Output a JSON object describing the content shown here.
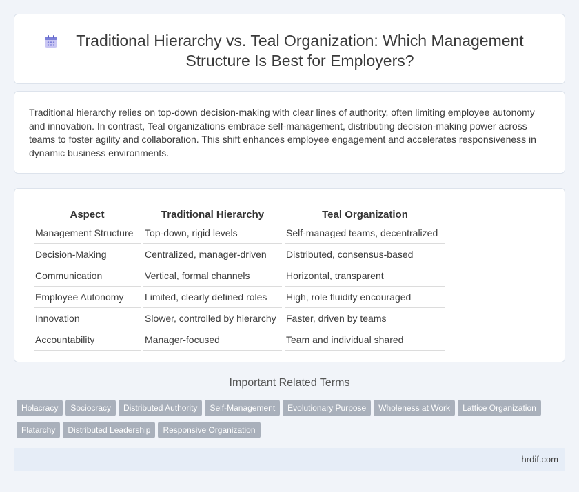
{
  "header": {
    "icon": "calendar-icon",
    "title": "Traditional Hierarchy vs. Teal Organization: Which Management Structure Is Best for Employers?"
  },
  "intro": {
    "text": "Traditional hierarchy relies on top-down decision-making with clear lines of authority, often limiting employee autonomy and innovation. In contrast, Teal organizations embrace self-management, distributing decision-making power across teams to foster agility and collaboration. This shift enhances employee engagement and accelerates responsiveness in dynamic business environments."
  },
  "comparison": {
    "headers": [
      "Aspect",
      "Traditional Hierarchy",
      "Teal Organization"
    ],
    "rows": [
      [
        "Management Structure",
        "Top-down, rigid levels",
        "Self-managed teams, decentralized"
      ],
      [
        "Decision-Making",
        "Centralized, manager-driven",
        "Distributed, consensus-based"
      ],
      [
        "Communication",
        "Vertical, formal channels",
        "Horizontal, transparent"
      ],
      [
        "Employee Autonomy",
        "Limited, clearly defined roles",
        "High, role fluidity encouraged"
      ],
      [
        "Innovation",
        "Slower, controlled by hierarchy",
        "Faster, driven by teams"
      ],
      [
        "Accountability",
        "Manager-focused",
        "Team and individual shared"
      ]
    ]
  },
  "related": {
    "title": "Important Related Terms",
    "tags": [
      "Holacracy",
      "Sociocracy",
      "Distributed Authority",
      "Self-Management",
      "Evolutionary Purpose",
      "Wholeness at Work",
      "Lattice Organization",
      "Flatarchy",
      "Distributed Leadership",
      "Responsive Organization"
    ]
  },
  "footer": {
    "site": "hrdif.com"
  },
  "colors": {
    "background": "#f1f4f9",
    "tag": "#a9b0bb",
    "footer": "#e6edf7",
    "icon_accent": "#7b7fd8"
  }
}
